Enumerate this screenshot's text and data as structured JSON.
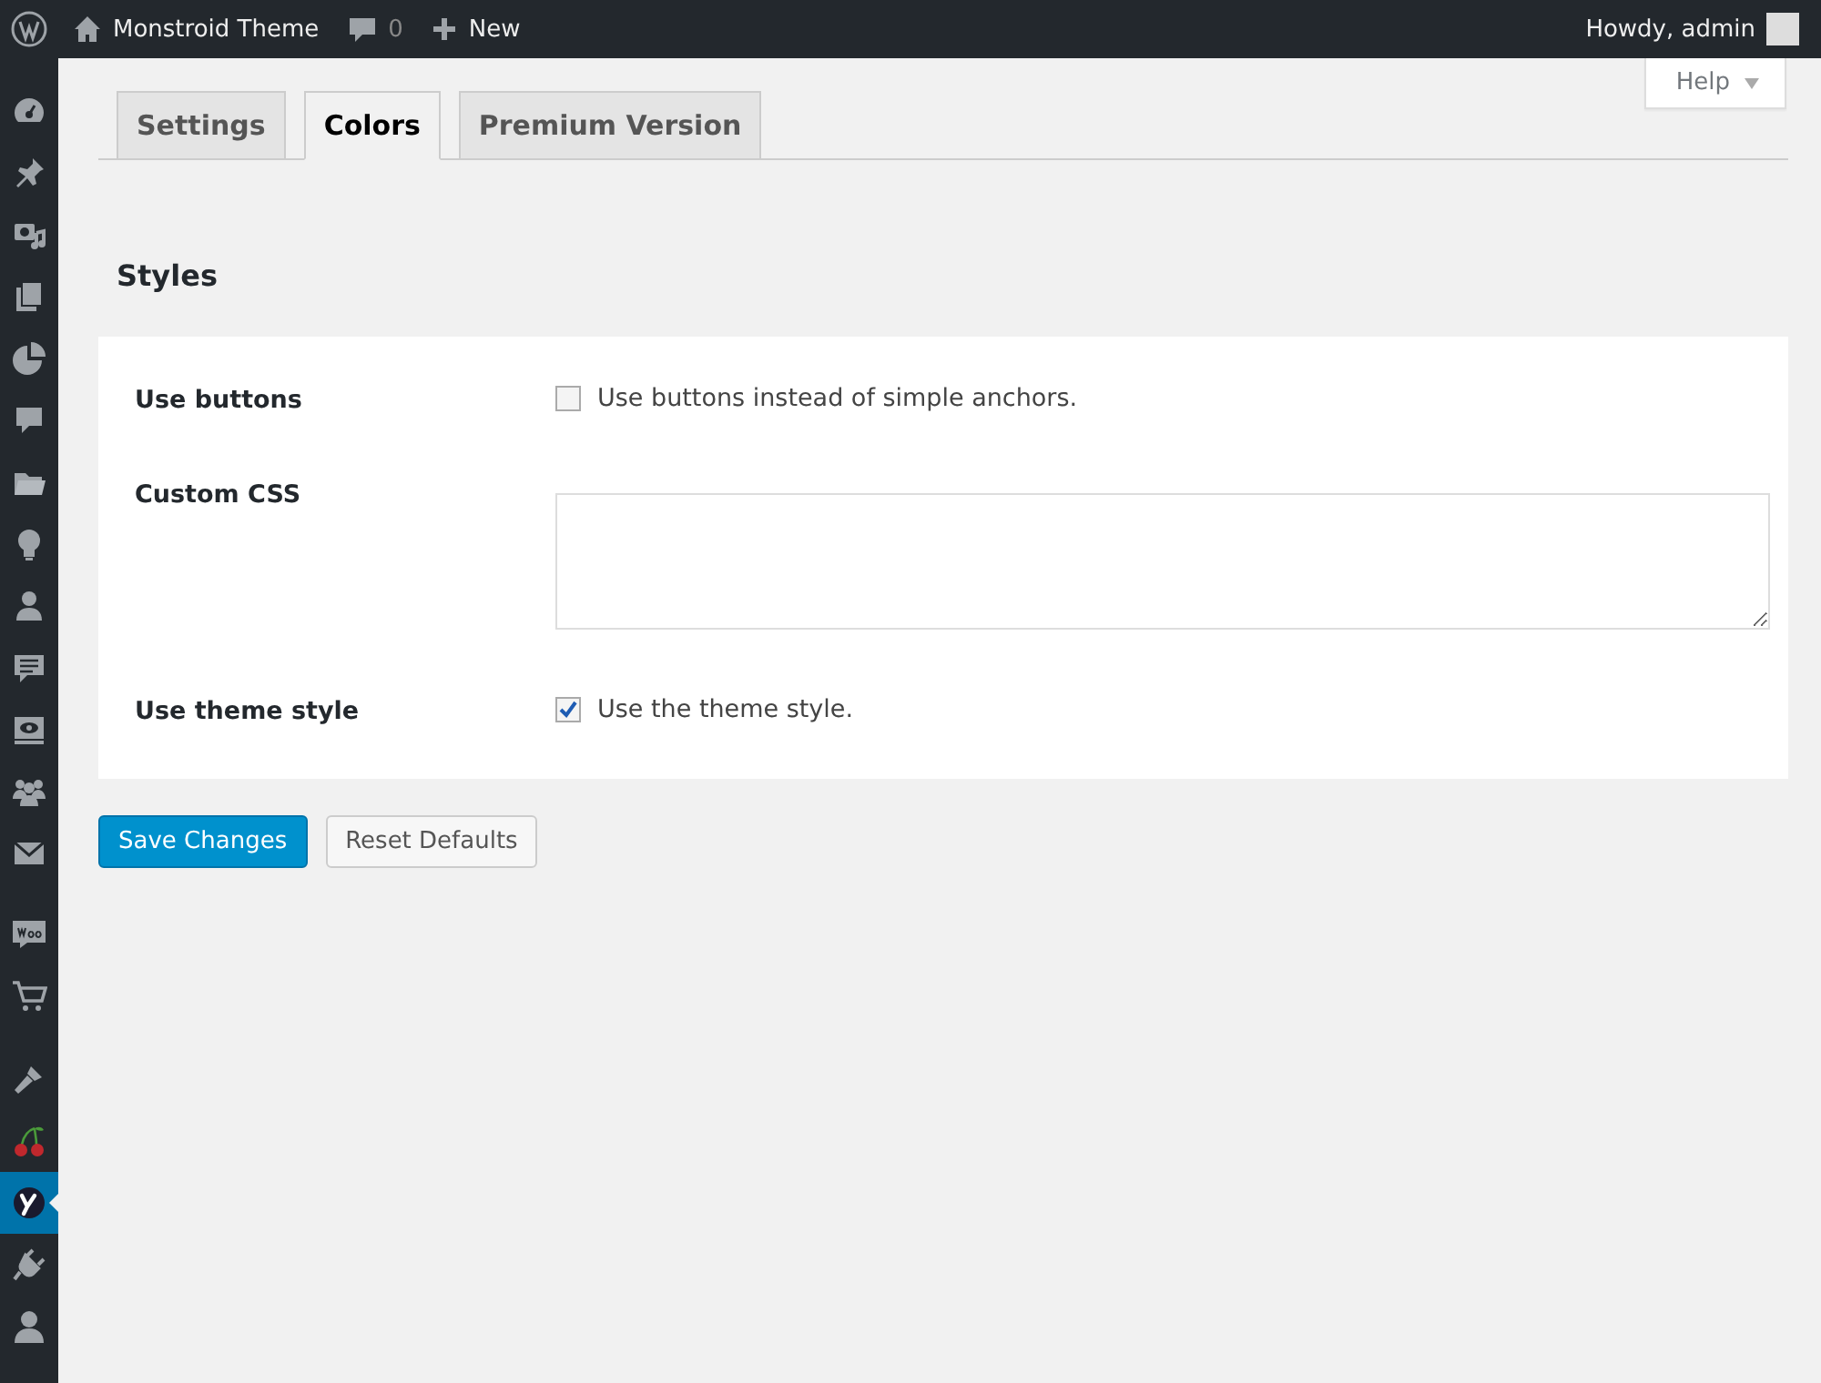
{
  "admin_bar": {
    "site_name": "Monstroid Theme",
    "comments_count": "0",
    "new_label": "New",
    "greeting": "Howdy, admin"
  },
  "sidebar": [
    {
      "kind": "dashboard",
      "selected": false
    },
    {
      "kind": "pin",
      "selected": false
    },
    {
      "kind": "media",
      "selected": false
    },
    {
      "kind": "pages",
      "selected": false
    },
    {
      "kind": "chart",
      "selected": false
    },
    {
      "kind": "comment",
      "selected": false
    },
    {
      "kind": "folder",
      "selected": false
    },
    {
      "kind": "bulb",
      "selected": false
    },
    {
      "kind": "person",
      "selected": false
    },
    {
      "kind": "feedback",
      "selected": false
    },
    {
      "kind": "screen",
      "selected": false
    },
    {
      "kind": "group",
      "selected": false
    },
    {
      "kind": "mail",
      "selected": false
    },
    {
      "kind": "woo",
      "selected": false
    },
    {
      "kind": "cart",
      "selected": false
    },
    {
      "kind": "brush",
      "selected": false
    },
    {
      "kind": "cherry",
      "selected": false
    },
    {
      "kind": "y",
      "selected": true
    },
    {
      "kind": "plug",
      "selected": false
    },
    {
      "kind": "user",
      "selected": false
    }
  ],
  "help_tab": {
    "label": "Help"
  },
  "tabs": [
    {
      "label": "Settings",
      "selected": false
    },
    {
      "label": "Colors",
      "selected": true
    },
    {
      "label": "Premium Version",
      "selected": false
    }
  ],
  "section_title": "Styles",
  "fields": [
    {
      "kind": "checkbox",
      "label": "Use buttons",
      "checked": false,
      "text": "Use buttons instead of simple anchors."
    },
    {
      "kind": "textarea",
      "label": "Custom CSS"
    },
    {
      "kind": "checkbox",
      "label": "Use theme style",
      "checked": true,
      "text": "Use the theme style."
    }
  ],
  "buttons": {
    "save": "Save Changes",
    "reset": "Reset Defaults"
  }
}
